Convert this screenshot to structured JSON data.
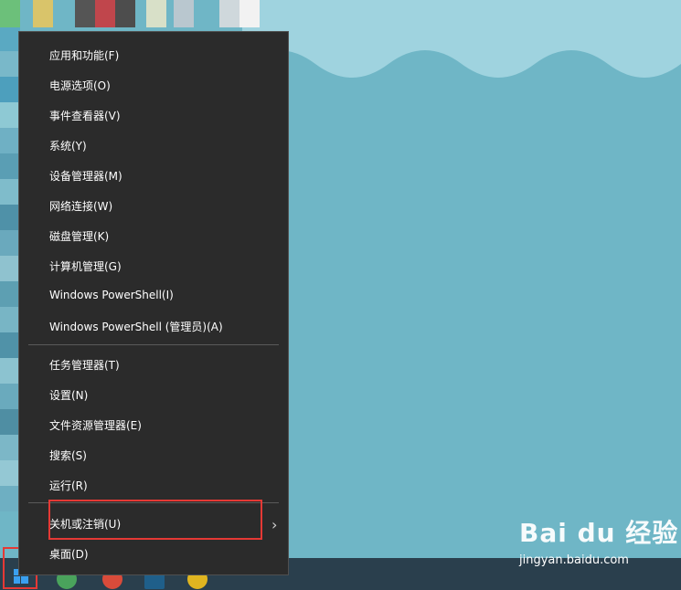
{
  "menu": {
    "items": [
      {
        "label": "应用和功能(F)"
      },
      {
        "label": "电源选项(O)"
      },
      {
        "label": "事件查看器(V)"
      },
      {
        "label": "系统(Y)"
      },
      {
        "label": "设备管理器(M)"
      },
      {
        "label": "网络连接(W)"
      },
      {
        "label": "磁盘管理(K)"
      },
      {
        "label": "计算机管理(G)"
      },
      {
        "label": "Windows PowerShell(I)"
      },
      {
        "label": "Windows PowerShell (管理员)(A)"
      },
      {
        "label": "任务管理器(T)"
      },
      {
        "label": "设置(N)"
      },
      {
        "label": "文件资源管理器(E)"
      },
      {
        "label": "搜索(S)"
      },
      {
        "label": "运行(R)"
      },
      {
        "label": "关机或注销(U)"
      },
      {
        "label": "桌面(D)"
      }
    ],
    "submenu_chevron": "›"
  },
  "watermark": {
    "logo": "Bai du 经验",
    "url": "jingyan.baidu.com"
  },
  "colors": {
    "menu_bg": "#2b2b2b",
    "highlight_border": "#e53935",
    "desktop": "#6fb6c6",
    "taskbar": "#2a3f4d"
  },
  "icons": [
    "windows-start-icon",
    "chevron-right-icon"
  ]
}
